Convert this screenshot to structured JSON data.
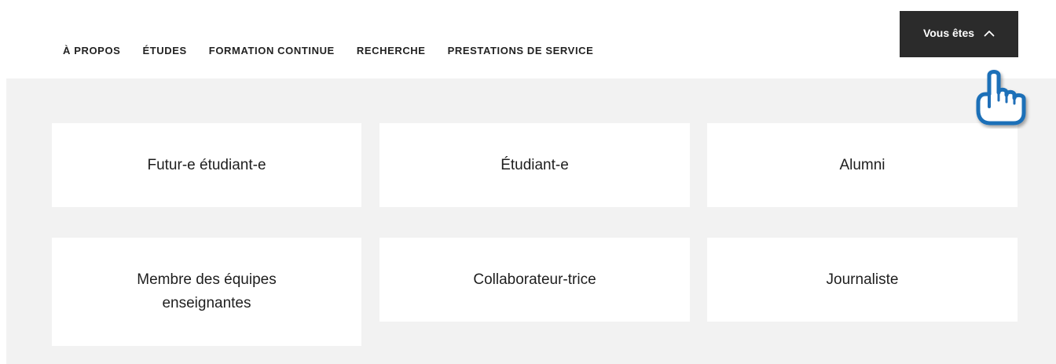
{
  "nav": {
    "items": [
      "À PROPOS",
      "ÉTUDES",
      "FORMATION CONTINUE",
      "RECHERCHE",
      "PRESTATIONS DE SERVICE"
    ]
  },
  "audience_toggle": {
    "label": "Vous êtes",
    "icon": "chevron-up-icon",
    "expanded": true
  },
  "audience_cards": [
    "Futur-e étudiant-e",
    "Étudiant-e",
    "Alumni",
    "Membre des équipes enseignantes",
    "Collaborateur-trice",
    "Journaliste"
  ],
  "cursor": {
    "icon": "hand-pointer-icon"
  },
  "colors": {
    "toggle_bg": "#2b2b2b",
    "panel_bg": "#f2f2f2",
    "card_bg": "#ffffff",
    "cursor_outline": "#1f6fb8"
  }
}
